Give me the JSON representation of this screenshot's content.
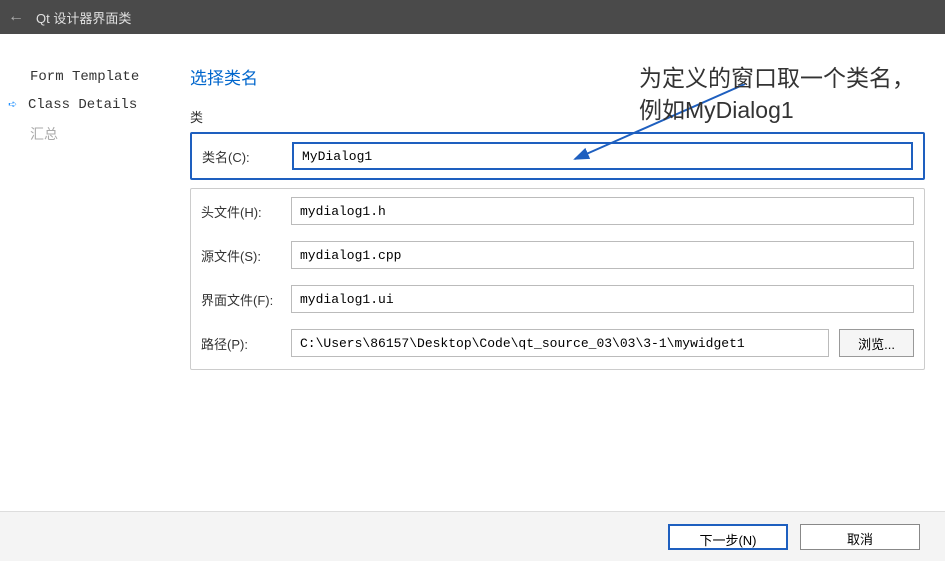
{
  "titleBar": {
    "title": "Qt 设计器界面类"
  },
  "sidebar": {
    "items": [
      {
        "label": "Form Template",
        "state": "done"
      },
      {
        "label": "Class Details",
        "state": "current"
      },
      {
        "label": "汇总",
        "state": "disabled"
      }
    ]
  },
  "main": {
    "pageTitle": "选择类名",
    "groupLabel": "类",
    "fields": {
      "className": {
        "label": "类名(C):",
        "value": "MyDialog1"
      },
      "headerFile": {
        "label": "头文件(H):",
        "value": "mydialog1.h"
      },
      "sourceFile": {
        "label": "源文件(S):",
        "value": "mydialog1.cpp"
      },
      "uiFile": {
        "label": "界面文件(F):",
        "value": "mydialog1.ui"
      },
      "path": {
        "label": "路径(P):",
        "value": "C:\\Users\\86157\\Desktop\\Code\\qt_source_03\\03\\3-1\\mywidget1"
      }
    },
    "browseButton": "浏览..."
  },
  "bottomBar": {
    "next": "下一步(N)",
    "cancel": "取消"
  },
  "annotation": {
    "line1": "为定义的窗口取一个类名，",
    "line2": "例如MyDialog1"
  }
}
